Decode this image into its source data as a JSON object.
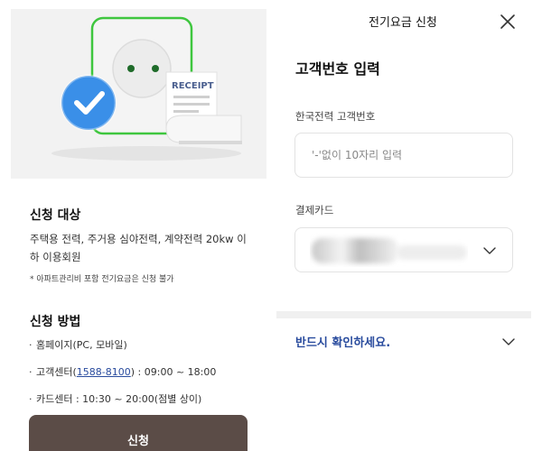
{
  "header": {
    "title": "전기요금 신청"
  },
  "form": {
    "title": "고객번호 입력",
    "customer_number": {
      "label": "한국전력 고객번호",
      "placeholder": "'-'없이 10자리 입력",
      "value": ""
    },
    "payment_card": {
      "label": "결제카드"
    }
  },
  "notice": {
    "label": "반드시 확인하세요."
  },
  "hero": {
    "receipt_text": "RECEIPT"
  },
  "eligibility": {
    "title": "신청 대상",
    "description": "주택용 전력, 주거용 심야전력, 계약전력 20kw 이하 이용회원",
    "note": "* 아파트관리비 포함 전기요금은 신청 불가"
  },
  "method": {
    "title": "신청 방법",
    "items": [
      {
        "text": "홈페이지(PC, 모바일)"
      },
      {
        "prefix": "고객센터(",
        "phone": "1588-8100",
        "suffix": ") : 09:00 ~ 18:00"
      },
      {
        "text": "카드센터 : 10:30 ~ 20:00(점별 상이)"
      }
    ]
  },
  "apply_button": {
    "label": "신청"
  },
  "colors": {
    "accent_blue": "#2a4c9e",
    "button_brown": "#5b4c47",
    "plug_green": "#3ec63e",
    "check_blue": "#3a8fe8"
  }
}
